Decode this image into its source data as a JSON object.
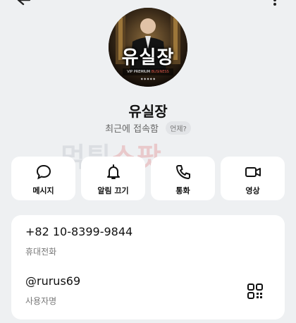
{
  "profile": {
    "name": "유실장",
    "status": "최근에 접속함",
    "status_when": "언제?",
    "avatar_text": "유실장"
  },
  "watermark": {
    "part_a": "먹튀",
    "part_b": "스팟"
  },
  "actions": [
    {
      "label": "메시지",
      "icon": "message-icon"
    },
    {
      "label": "알림 끄기",
      "icon": "bell-icon"
    },
    {
      "label": "통화",
      "icon": "phone-icon"
    },
    {
      "label": "영상",
      "icon": "video-icon"
    }
  ],
  "contact": {
    "phone": "+82 10-8399-9844",
    "phone_type": "휴대전화",
    "username": "@rurus69",
    "username_label": "사용자명"
  }
}
